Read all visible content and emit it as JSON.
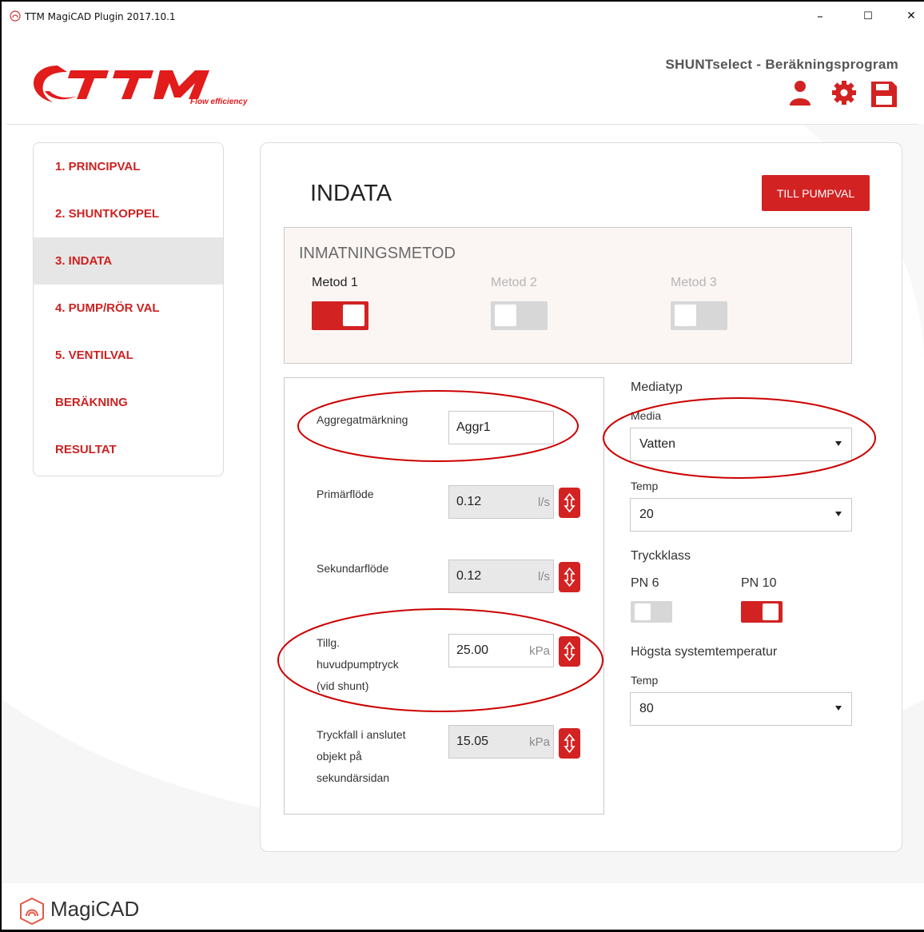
{
  "window": {
    "title": "TTM MagiCAD Plugin 2017.10.1",
    "minimize": "–",
    "maximize": "☐",
    "close": "✕"
  },
  "header": {
    "logo_text": "TTM",
    "logo_tagline": "Flow efficiency",
    "heading": "SHUNTselect - Beräkningsprogram",
    "icons": [
      "user-icon",
      "gear-icon",
      "save-icon"
    ]
  },
  "sidebar": {
    "items": [
      {
        "label": "1. PRINCIPVAL",
        "active": false
      },
      {
        "label": "2. SHUNTKOPPEL",
        "active": false
      },
      {
        "label": "3. INDATA",
        "active": true
      },
      {
        "label": "4. PUMP/RÖR VAL",
        "active": false
      },
      {
        "label": "5. VENTILVAL",
        "active": false
      },
      {
        "label": "BERÄKNING",
        "active": false
      },
      {
        "label": "RESULTAT",
        "active": false
      }
    ]
  },
  "main": {
    "title": "INDATA",
    "next_button": "TILL PUMPVAL",
    "input_method": {
      "title": "INMATNINGSMETOD",
      "methods": [
        {
          "label": "Metod 1",
          "on": true
        },
        {
          "label": "Metod 2",
          "on": false
        },
        {
          "label": "Metod 3",
          "on": false
        }
      ]
    },
    "fields": {
      "aggregat": {
        "label": "Aggregatmärkning",
        "value": "Aggr1"
      },
      "primarflode": {
        "label": "Primärflöde",
        "value": "0.12",
        "unit": "l/s"
      },
      "sekundarflode": {
        "label": "Sekundarflöde",
        "value": "0.12",
        "unit": "l/s"
      },
      "pumptryck": {
        "label_lines": [
          "Tillg.",
          "huvudpumptryck",
          "(vid shunt)"
        ],
        "value": "25.00",
        "unit": "kPa"
      },
      "tryckfall": {
        "label_lines": [
          "Tryckfall i anslutet",
          "objekt på",
          "sekundärsidan"
        ],
        "value": "15.05",
        "unit": "kPa"
      }
    },
    "mediatyp": {
      "title": "Mediatyp",
      "media_label": "Media",
      "media_value": "Vatten",
      "temp_label": "Temp",
      "temp_value": "20"
    },
    "tryckklass": {
      "title": "Tryckklass",
      "options": [
        {
          "label": "PN 6",
          "on": false
        },
        {
          "label": "PN 10",
          "on": true
        }
      ]
    },
    "systemtemp": {
      "title": "Högsta systemtemperatur",
      "temp_label": "Temp",
      "temp_value": "80"
    }
  },
  "footer": {
    "brand": "MagiCAD"
  },
  "colors": {
    "accent": "#d32222",
    "annotation": "#cc0000",
    "active_nav_bg": "#e6e6e6"
  }
}
